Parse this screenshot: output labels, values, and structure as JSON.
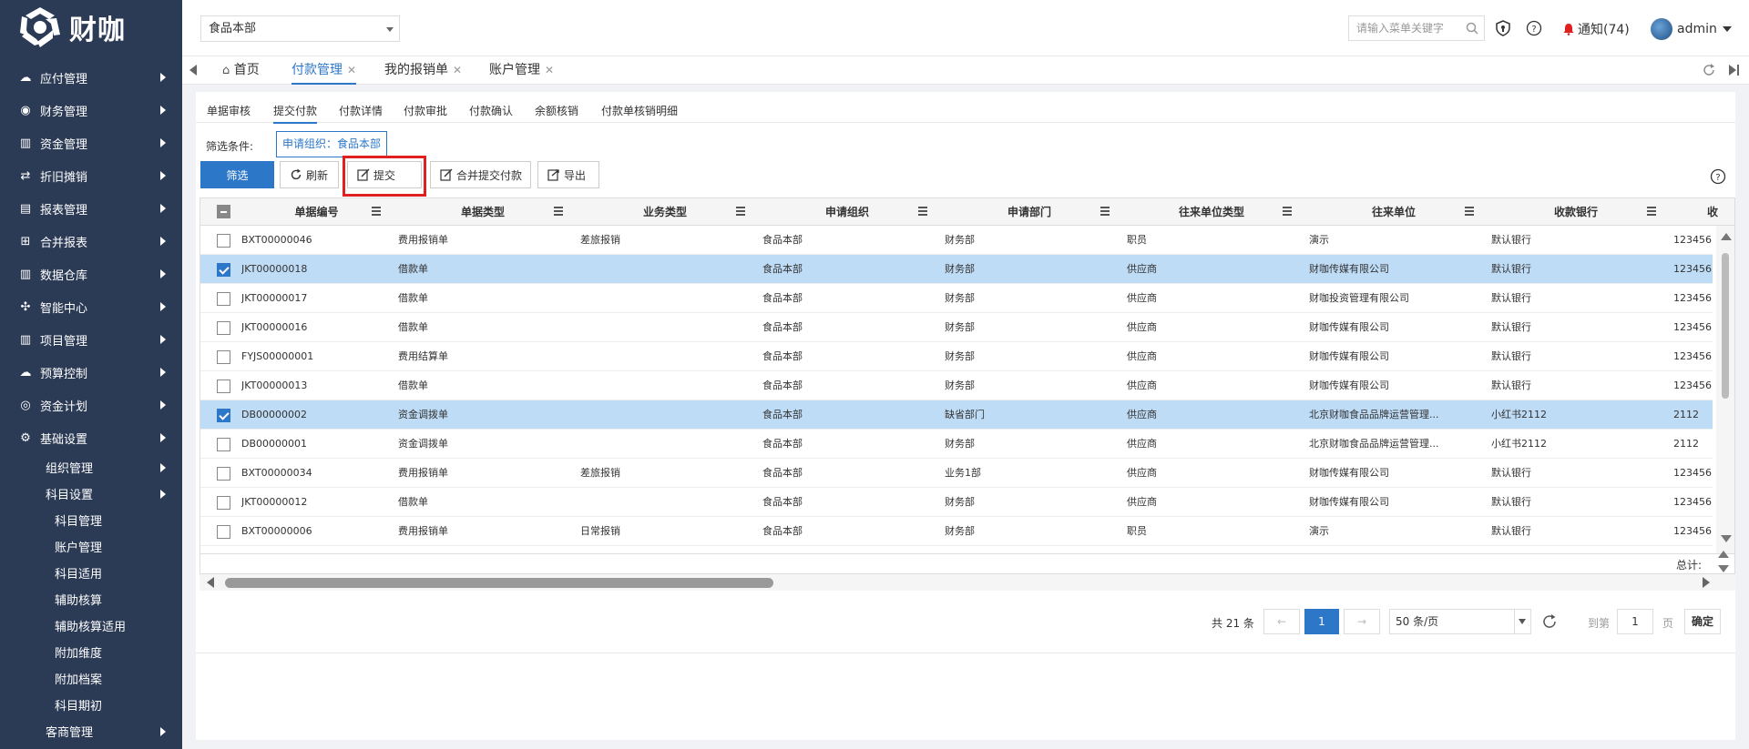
{
  "brand": {
    "name": "财咖"
  },
  "sidebar": {
    "items": [
      {
        "label": "应付管理",
        "icon": "cloud-icon"
      },
      {
        "label": "财务管理",
        "icon": "target-icon"
      },
      {
        "label": "资金管理",
        "icon": "bar-chart-icon"
      },
      {
        "label": "折旧摊销",
        "icon": "depreciation-icon"
      },
      {
        "label": "报表管理",
        "icon": "report-icon"
      },
      {
        "label": "合并报表",
        "icon": "merge-icon"
      },
      {
        "label": "数据仓库",
        "icon": "warehouse-icon"
      },
      {
        "label": "智能中心",
        "icon": "compass-icon"
      },
      {
        "label": "项目管理",
        "icon": "project-icon"
      },
      {
        "label": "预算控制",
        "icon": "budget-icon"
      },
      {
        "label": "资金计划",
        "icon": "coins-icon"
      },
      {
        "label": "基础设置",
        "icon": "gear-icon"
      }
    ],
    "sub_items": [
      {
        "label": "组织管理"
      },
      {
        "label": "科目设置"
      }
    ],
    "subsub_items": [
      {
        "label": "科目管理"
      },
      {
        "label": "账户管理"
      },
      {
        "label": "科目适用"
      },
      {
        "label": "辅助核算"
      },
      {
        "label": "辅助核算适用"
      },
      {
        "label": "附加维度"
      },
      {
        "label": "附加档案"
      },
      {
        "label": "科目期初"
      }
    ],
    "last_item": {
      "label": "客商管理"
    }
  },
  "header": {
    "org_select": "食品本部",
    "search_placeholder": "请输入菜单关键字",
    "notify": "通知(74)",
    "user": "admin"
  },
  "tabs": [
    {
      "label": "首页"
    },
    {
      "label": "付款管理"
    },
    {
      "label": "我的报销单"
    },
    {
      "label": "账户管理"
    }
  ],
  "subtabs": [
    "单据审核",
    "提交付款",
    "付款详情",
    "付款审批",
    "付款确认",
    "余额核销",
    "付款单核销明细"
  ],
  "filter": {
    "label": "筛选条件:",
    "tag": "申请组织：食品本部"
  },
  "toolbar": {
    "filter": "筛选",
    "refresh": "刷新",
    "submit": "提交",
    "merge_submit": "合并提交付款",
    "export": "导出"
  },
  "table": {
    "columns": [
      "单据编号",
      "单据类型",
      "业务类型",
      "申请组织",
      "申请部门",
      "往来单位类型",
      "往来单位",
      "收款银行",
      "收"
    ],
    "rows": [
      {
        "checked": false,
        "cells": [
          "BXT00000046",
          "费用报销单",
          "差旅报销",
          "食品本部",
          "财务部",
          "职员",
          "演示",
          "默认银行",
          "123456"
        ]
      },
      {
        "checked": true,
        "cells": [
          "JKT00000018",
          "借款单",
          "",
          "食品本部",
          "财务部",
          "供应商",
          "财咖传媒有限公司",
          "默认银行",
          "123456"
        ]
      },
      {
        "checked": false,
        "cells": [
          "JKT00000017",
          "借款单",
          "",
          "食品本部",
          "财务部",
          "供应商",
          "财咖投资管理有限公司",
          "默认银行",
          "123456"
        ]
      },
      {
        "checked": false,
        "cells": [
          "JKT00000016",
          "借款单",
          "",
          "食品本部",
          "财务部",
          "供应商",
          "财咖传媒有限公司",
          "默认银行",
          "123456"
        ]
      },
      {
        "checked": false,
        "cells": [
          "FYJS00000001",
          "费用结算单",
          "",
          "食品本部",
          "财务部",
          "供应商",
          "财咖传媒有限公司",
          "默认银行",
          "123456"
        ]
      },
      {
        "checked": false,
        "cells": [
          "JKT00000013",
          "借款单",
          "",
          "食品本部",
          "财务部",
          "供应商",
          "财咖传媒有限公司",
          "默认银行",
          "123456"
        ]
      },
      {
        "checked": true,
        "cells": [
          "DB00000002",
          "资金调拨单",
          "",
          "食品本部",
          "缺省部门",
          "供应商",
          "北京财咖食品品牌运营管理...",
          "小红书2112",
          "2112"
        ]
      },
      {
        "checked": false,
        "cells": [
          "DB00000001",
          "资金调拨单",
          "",
          "食品本部",
          "财务部",
          "供应商",
          "北京财咖食品品牌运营管理...",
          "小红书2112",
          "2112"
        ]
      },
      {
        "checked": false,
        "cells": [
          "BXT00000034",
          "费用报销单",
          "差旅报销",
          "食品本部",
          "业务1部",
          "供应商",
          "财咖传媒有限公司",
          "默认银行",
          "123456"
        ]
      },
      {
        "checked": false,
        "cells": [
          "JKT00000012",
          "借款单",
          "",
          "食品本部",
          "财务部",
          "供应商",
          "财咖传媒有限公司",
          "默认银行",
          "123456"
        ]
      },
      {
        "checked": false,
        "cells": [
          "BXT00000006",
          "费用报销单",
          "日常报销",
          "食品本部",
          "财务部",
          "职员",
          "演示",
          "默认银行",
          "123456"
        ]
      }
    ],
    "summary_label": "总计:"
  },
  "pager": {
    "total": "共 21 条",
    "current": "1",
    "page_size": "50 条/页",
    "goto_label": "到第",
    "goto_value": "1",
    "page_unit": "页",
    "confirm": "确定"
  },
  "colors": {
    "sidebar": "#2b3a55",
    "accent": "#2d77c8",
    "selected_row": "#bfdcf6",
    "highlight": "#e02020"
  }
}
